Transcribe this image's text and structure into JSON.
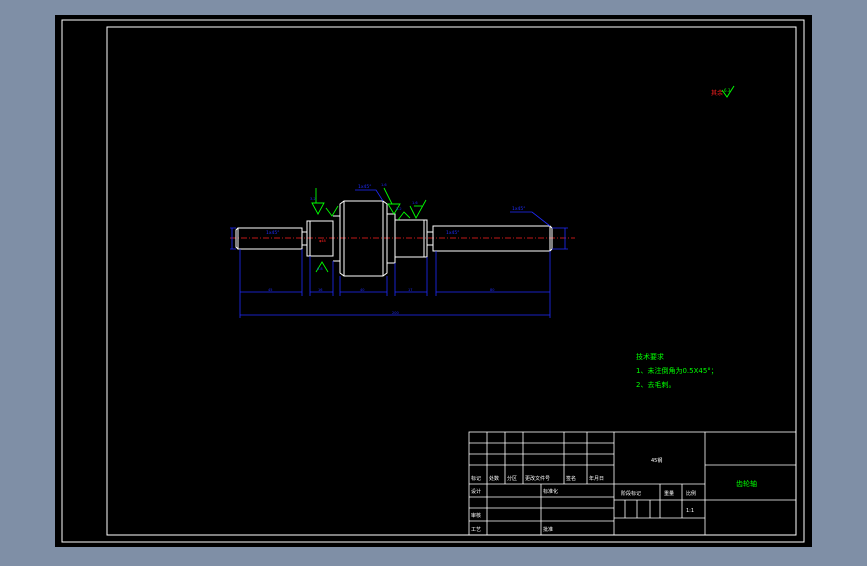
{
  "colors": {
    "background": "#7f8fa6",
    "canvas": "#000000",
    "frame": "#ffffff",
    "part": "#ffffff",
    "dimension": "#1f2bff",
    "symbol": "#00ff00",
    "centerline": "#ff2020",
    "text": "#00ff00",
    "title_text": "#ffffff",
    "title_accent": "#00ff00"
  },
  "roughness_note": {
    "symbol": "其余",
    "value": "6.3"
  },
  "dimensions": {
    "chamfer_top_left": "1x45°",
    "chamfer_top_right": "1x45°",
    "left_shaft_label": "1x45°",
    "right_shaft_label": "1x45°",
    "roughness_1": "3.2",
    "roughness_2": "1.6",
    "roughness_3": "1.6",
    "roughness_4": "0.8",
    "roughness_5": "3.2",
    "len_1": "45",
    "len_2": "16",
    "len_3": "40",
    "len_4": "17",
    "len_5": "80",
    "total_length": "200",
    "dia_center": "φ48"
  },
  "tech_notes": {
    "heading": "技术要求",
    "line1": "1、未注倒角为0.5X45°；",
    "line2": "2、去毛刺。"
  },
  "title_block": {
    "drawing_no": "45钢",
    "part_name": "齿轮轴",
    "headers": [
      "标记",
      "处数",
      "分区",
      "更改文件号",
      "签名",
      "年月日"
    ],
    "designer_label": "设计",
    "standard_label": "标准化",
    "review_label": "审核",
    "process_label": "工艺",
    "approve_label": "批准",
    "stage_label": "阶段标记",
    "weight_label": "重量",
    "scale_label": "比例",
    "scale_value": "1:1"
  }
}
